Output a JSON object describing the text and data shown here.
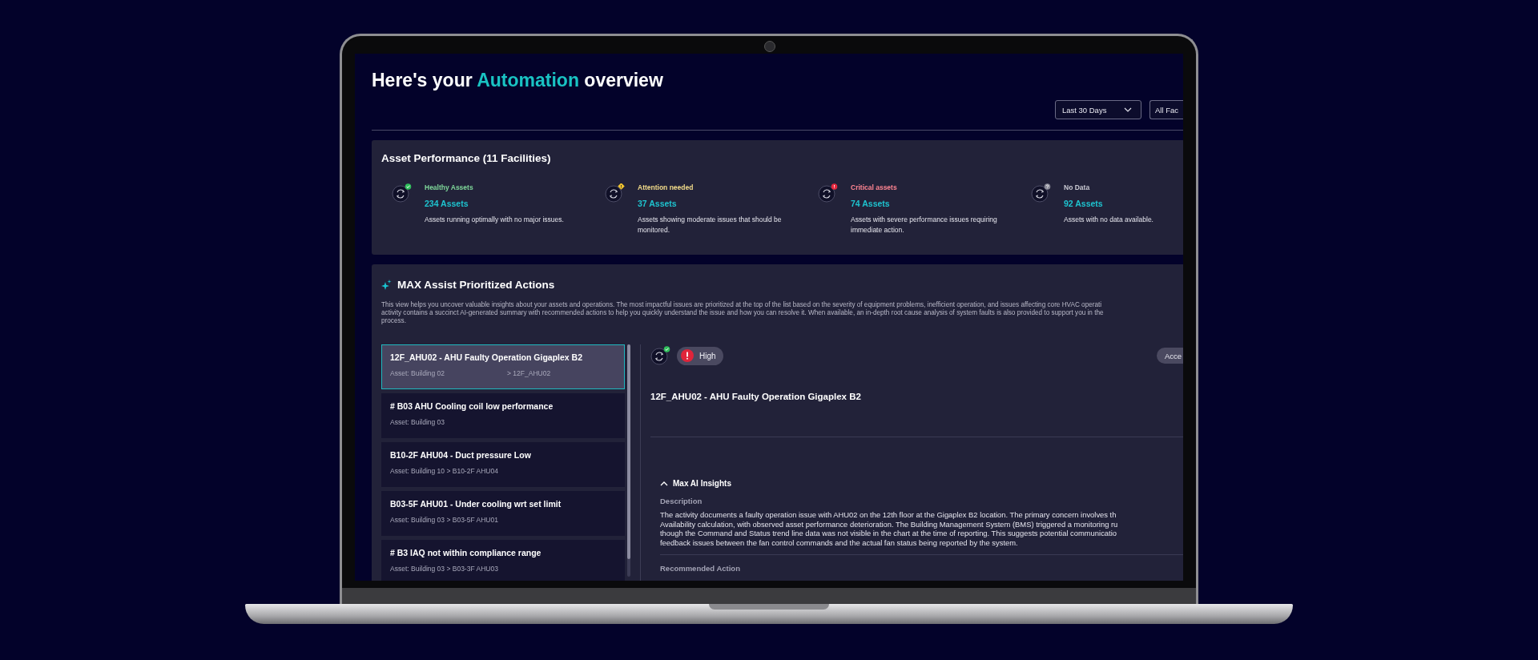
{
  "header": {
    "title": {
      "before": "Here's your ",
      "highlight": "Automation",
      "after": " overview"
    }
  },
  "filters": [
    {
      "label": "Last 30 Days",
      "kind": "dropdown"
    },
    {
      "label": "All Fac",
      "kind": "cut"
    }
  ],
  "asset_performance": {
    "title": "Asset Performance (11 Facilities)",
    "stats": [
      {
        "kind": "healthy",
        "label": "Healthy Assets",
        "count": "234 Assets",
        "description": "Assets running optimally with no major issues."
      },
      {
        "kind": "attention",
        "label": "Attention needed",
        "count": "37 Assets",
        "description": "Assets showing moderate issues that should be monitored."
      },
      {
        "kind": "critical",
        "label": "Critical assets",
        "count": "74 Assets",
        "description": "Assets with severe performance issues requiring immediate action."
      },
      {
        "kind": "nodata",
        "label": "No Data",
        "count": "92 Assets",
        "description": "Assets with no data available."
      }
    ]
  },
  "prioritized_actions": {
    "title": "MAX Assist Prioritized Actions",
    "intro_lines": [
      "This view helps you uncover valuable insights about your assets and operations. The most impactful issues are prioritized at the top of the list based on the severity of equipment problems, inefficient operation, and issues affecting core HVAC operati",
      "activity contains a succinct AI-generated summary with recommended actions to help you quickly understand the issue and how you can resolve it. When available, an in-depth root cause analysis of system faults is also provided to support you in the",
      "process."
    ],
    "actions": [
      {
        "title": "12F_AHU02 - AHU Faulty Operation Gigaplex B2",
        "meta": [
          "Asset: Building 02",
          "> 12F_AHU02"
        ],
        "selected": true
      },
      {
        "title": "# B03 AHU Cooling coil low performance",
        "meta": [
          "Asset: Building 03"
        ],
        "selected": false
      },
      {
        "title": "B10-2F AHU04 - Duct pressure Low",
        "meta": [
          "Asset: Building 10 > B10-2F AHU04"
        ],
        "selected": false
      },
      {
        "title": "B03-5F AHU01 - Under cooling wrt set limit",
        "meta": [
          "Asset: Building 03 > B03-5F AHU01"
        ],
        "selected": false
      },
      {
        "title": "# B3 IAQ not within compliance range",
        "meta": [
          "Asset: Building 03 > B03-3F AHU03"
        ],
        "selected": false
      }
    ],
    "detail": {
      "kind": "healthy",
      "priority": {
        "label": "High",
        "kind": "high"
      },
      "button": "Acce",
      "title": "12F_AHU02 - AHU Faulty Operation Gigaplex B2",
      "insights": {
        "title": "Max AI Insights",
        "expanded": true,
        "description_label": "Description",
        "description_lines": [
          "The activity documents a faulty operation issue with AHU02 on the 12th floor at the Gigaplex B2 location. The primary concern involves th",
          "Availability calculation, with observed asset performance deterioration. The Building Management System (BMS) triggered a monitoring ru",
          "though the Command and Status trend line data was not visible in the chart at the time of reporting. This suggests potential communicatio",
          "feedback issues between the fan control commands and the actual fan status being reported by the system."
        ],
        "next_label": "Recommended Action"
      }
    }
  }
}
